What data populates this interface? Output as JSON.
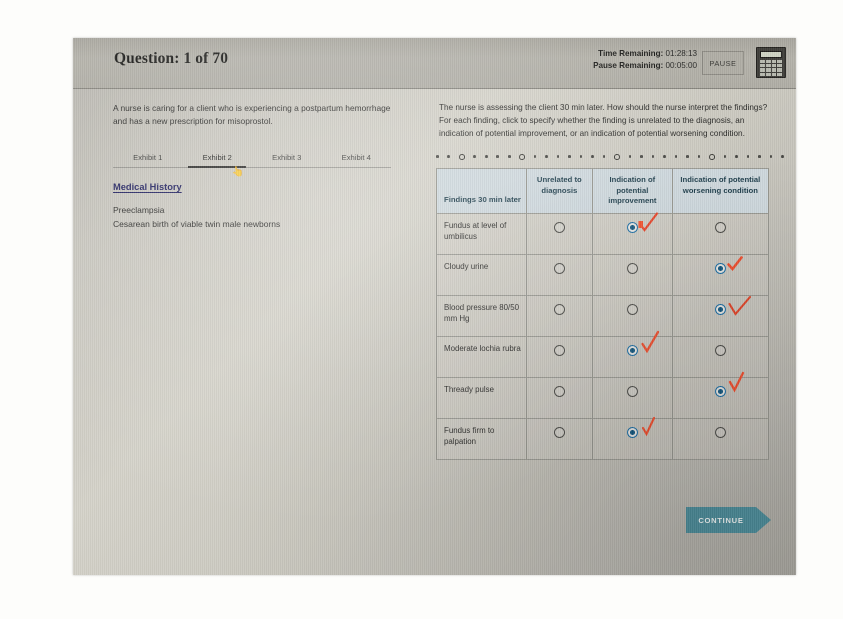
{
  "header": {
    "question_label": "Question: 1 of 70",
    "time_remaining_label": "Time Remaining:",
    "time_remaining_value": "01:28:13",
    "pause_remaining_label": "Pause Remaining:",
    "pause_remaining_value": "00:05:00",
    "pause_button": "PAUSE",
    "calculator_icon": "calculator-icon"
  },
  "left": {
    "stem": "A nurse is caring for a client who is experiencing a postpartum hemorrhage and has a new prescription for misoprostol.",
    "tabs": [
      {
        "label": "Exhibit 1",
        "active": false
      },
      {
        "label": "Exhibit 2",
        "active": true
      },
      {
        "label": "Exhibit 3",
        "active": false
      },
      {
        "label": "Exhibit 4",
        "active": false
      }
    ],
    "section_title": "Medical History",
    "history": [
      "Preeclampsia",
      "Cesarean birth of viable twin male newborns"
    ]
  },
  "right": {
    "prompt_1": "The nurse is assessing the client 30 min later. How should the nurse interpret the findings?",
    "prompt_2": "For each finding, click to specify whether the finding is unrelated to the diagnosis, an indication of potential improvement, or an indication of potential worsening condition.",
    "table": {
      "headers": [
        "Findings 30 min later",
        "Unrelated to diagnosis",
        "Indication of potential improvement",
        "Indication of potential worsening condition"
      ],
      "rows": [
        {
          "finding": "Fundus at level of umbilicus",
          "selected": 2,
          "mark": 2
        },
        {
          "finding": "Cloudy urine",
          "selected": 3,
          "mark": 3
        },
        {
          "finding": "Blood pressure 80/50 mm Hg",
          "selected": 3,
          "mark": 3
        },
        {
          "finding": "Moderate lochia rubra",
          "selected": 2,
          "mark": 2
        },
        {
          "finding": "Thready pulse",
          "selected": 3,
          "mark": 3
        },
        {
          "finding": "Fundus firm to palpation",
          "selected": 2,
          "mark": 2
        }
      ]
    },
    "continue_button": "CONTINUE"
  },
  "colors": {
    "header_bar": "#b0aea6",
    "table_header": "#cfd9de",
    "radio_selected": "#13577f",
    "annotation_red": "#e8452a",
    "continue_teal": "#4d8e9c",
    "section_title": "#1d1d5e"
  }
}
